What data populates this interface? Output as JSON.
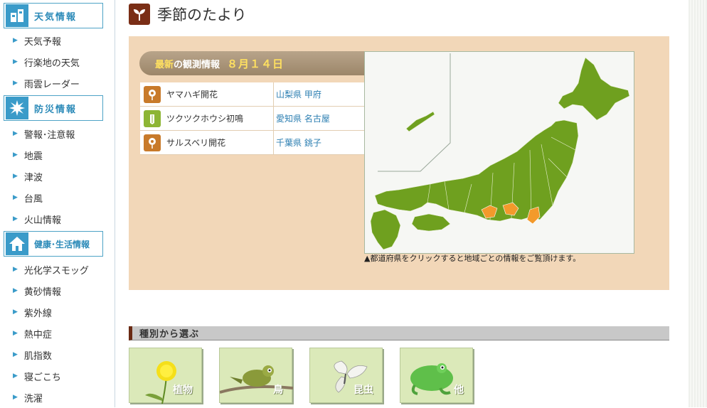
{
  "sidebar": {
    "weather": {
      "title": "天気情報",
      "items": [
        "天気予報",
        "行楽地の天気",
        "雨雲レーダー"
      ]
    },
    "disaster": {
      "title": "防災情報",
      "items": [
        "警報･注意報",
        "地震",
        "津波",
        "台風",
        "火山情報"
      ]
    },
    "health": {
      "title": "健康･生活情報",
      "items": [
        "光化学スモッグ",
        "黄砂情報",
        "紫外線",
        "熱中症",
        "肌指数",
        "寝ごこち",
        "洗濯"
      ]
    }
  },
  "header": {
    "title": "季節のたより"
  },
  "observation": {
    "label_new": "最新",
    "label_rest": "の観測情報",
    "date": "８月１４日",
    "rows": [
      {
        "name": "ヤマハギ開花",
        "location": "山梨県 甲府",
        "icon": "flower-icon",
        "color": "#c87a2a"
      },
      {
        "name": "ツクツクホウシ初鳴",
        "location": "愛知県 名古屋",
        "icon": "insect-icon",
        "color": "#8db534"
      },
      {
        "name": "サルスベリ開花",
        "location": "千葉県 銚子",
        "icon": "flower-icon",
        "color": "#c87a2a"
      }
    ],
    "note": "▲都道府県をクリックすると地域ごとの情報をご覧頂けます。"
  },
  "species": {
    "title": "種別から選ぶ",
    "tiles": [
      {
        "label": "植物",
        "icon": "dandelion-icon"
      },
      {
        "label": "鳥",
        "icon": "bird-icon"
      },
      {
        "label": "昆虫",
        "icon": "butterfly-icon"
      },
      {
        "label": "他",
        "icon": "frog-icon"
      }
    ]
  },
  "colors": {
    "accent": "#3a9bc9",
    "brown": "#7a2e16",
    "panel": "#f2d7b8",
    "map_green": "#6fa01f",
    "map_highlight": "#f39a2b"
  }
}
